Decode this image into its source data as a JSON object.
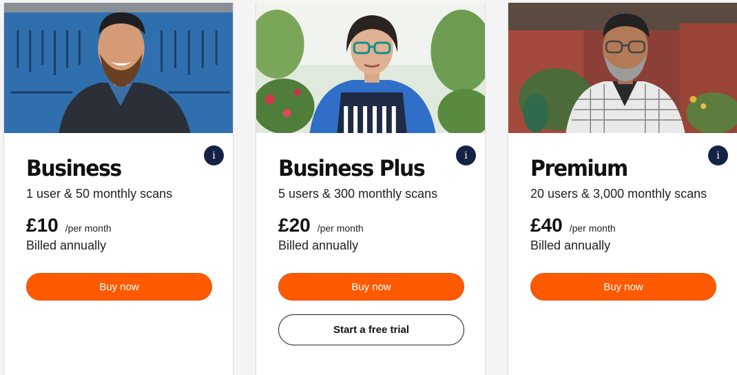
{
  "colors": {
    "accent": "#ff5a00",
    "info_badge": "#142244",
    "text": "#111111"
  },
  "plans": [
    {
      "name": "Business",
      "users_scans": "1 user & 50 monthly scans",
      "price": "£10",
      "period": "/per month",
      "billing": "Billed annually",
      "buy_label": "Buy now",
      "info_label": "i",
      "photo_icon": "mechanic-photo"
    },
    {
      "name": "Business Plus",
      "users_scans": "5 users & 300 monthly scans",
      "price": "£20",
      "period": "/per month",
      "billing": "Billed annually",
      "buy_label": "Buy now",
      "trial_label": "Start a free trial",
      "info_label": "i",
      "photo_icon": "florist-photo"
    },
    {
      "name": "Premium",
      "users_scans": "20 users & 3,000 monthly scans",
      "price": "£40",
      "period": "/per month",
      "billing": "Billed annually",
      "buy_label": "Buy now",
      "info_label": "i",
      "photo_icon": "shop-owner-photo"
    }
  ]
}
